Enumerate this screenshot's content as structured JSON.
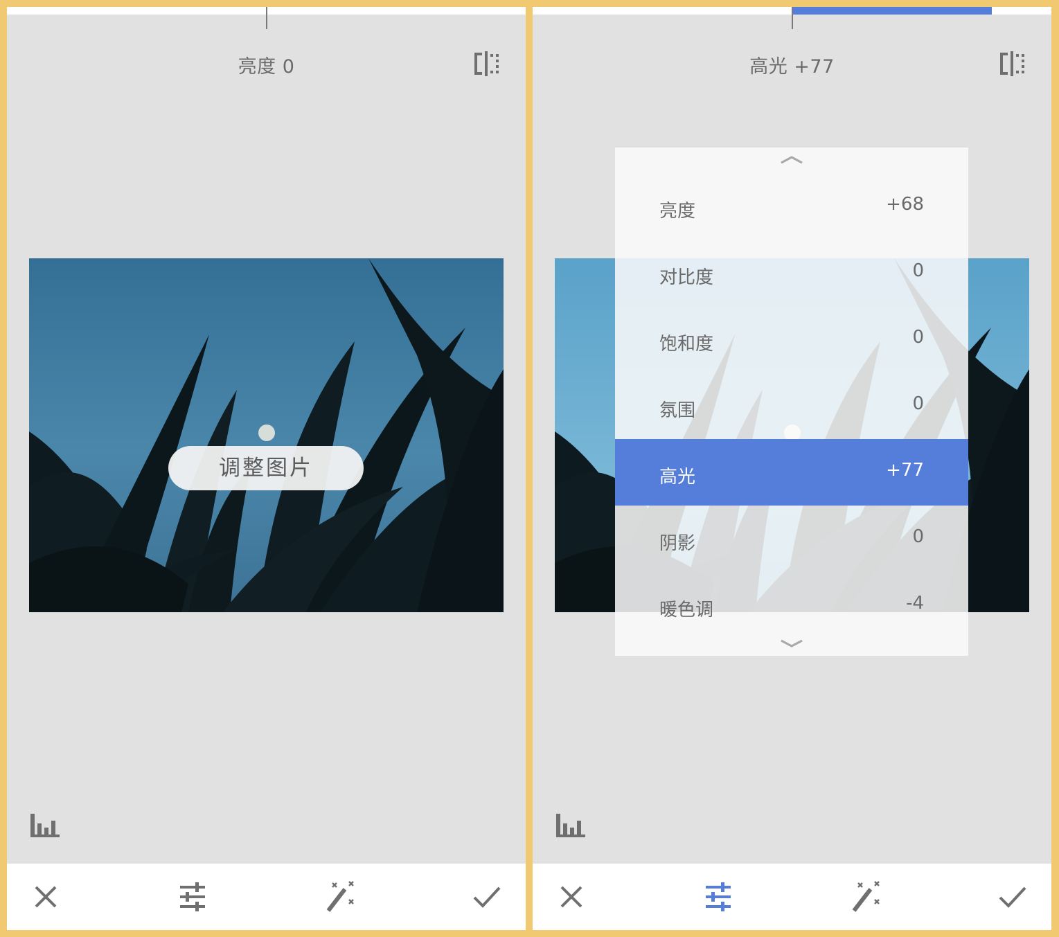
{
  "colors": {
    "frame": "#f1c971",
    "background": "#e1e1e1",
    "accent_blue": "#557edb",
    "icon_gray": "#6f6f6f"
  },
  "left_panel": {
    "header_title": "亮度 0",
    "hint_label": "调整图片",
    "slider_value": 0,
    "icons": [
      "compare-icon",
      "histogram-icon",
      "close-icon",
      "tune-icon",
      "magic-wand-icon",
      "check-icon"
    ]
  },
  "right_panel": {
    "header_title": "高光 +77",
    "slider_value": 77,
    "menu": {
      "items": [
        {
          "label": "亮度",
          "value": "+68"
        },
        {
          "label": "对比度",
          "value": "0"
        },
        {
          "label": "饱和度",
          "value": "0"
        },
        {
          "label": "氛围",
          "value": "0"
        },
        {
          "label": "高光",
          "value": "+77",
          "selected": true
        },
        {
          "label": "阴影",
          "value": "0"
        },
        {
          "label": "暖色调",
          "value": "-4"
        }
      ]
    },
    "icons": [
      "compare-icon",
      "histogram-icon",
      "close-icon",
      "tune-icon",
      "magic-wand-icon",
      "check-icon"
    ]
  }
}
